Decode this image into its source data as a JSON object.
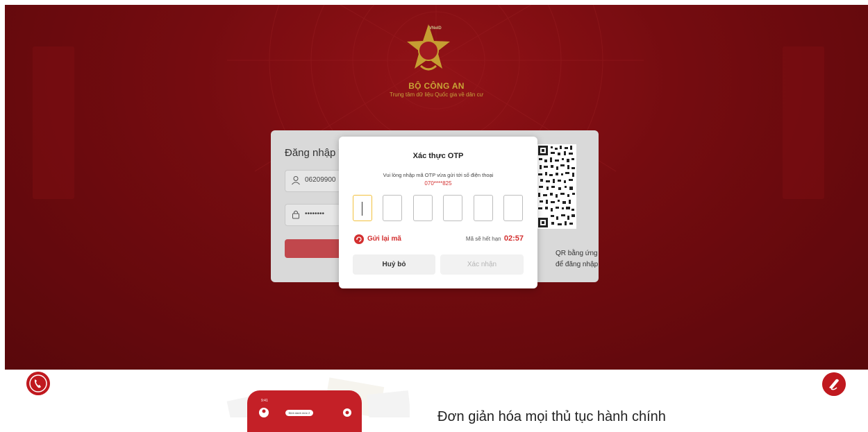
{
  "brand": {
    "emblem_text": "VNeID",
    "title": "BỘ CÔNG AN",
    "subtitle": "Trung tâm dữ liệu Quốc gia về dân cư"
  },
  "login": {
    "title": "Đăng nhập V",
    "username_value": "06209900",
    "password_value": "••••••••",
    "qr_hint_line1": "QR bằng ứng",
    "qr_hint_line2": "để đăng nhập."
  },
  "otp_modal": {
    "title": "Xác thực OTP",
    "message": "Vui lòng nhập mã OTP vừa gửi tới số điện thoại",
    "phone": "070****825",
    "digits": [
      "",
      "",
      "",
      "",
      "",
      ""
    ],
    "resend_label": "Gửi lại mã",
    "expire_label": "Mã sẽ hết hạn",
    "expire_time": "02:57",
    "cancel_label": "Huỷ bỏ",
    "confirm_label": "Xác nhận"
  },
  "bottom": {
    "heading": "Đơn giản hóa mọi thủ tục hành chính",
    "phone_time": "9:41",
    "phone_pill": "Định danh mức 2"
  },
  "colors": {
    "brand_red": "#b8161c",
    "accent_gold": "#f5c842",
    "error_red": "#d32f2f"
  },
  "icons": [
    "user-icon",
    "lock-icon",
    "refresh-icon",
    "phone-icon",
    "book-icon",
    "qr-code-icon"
  ]
}
